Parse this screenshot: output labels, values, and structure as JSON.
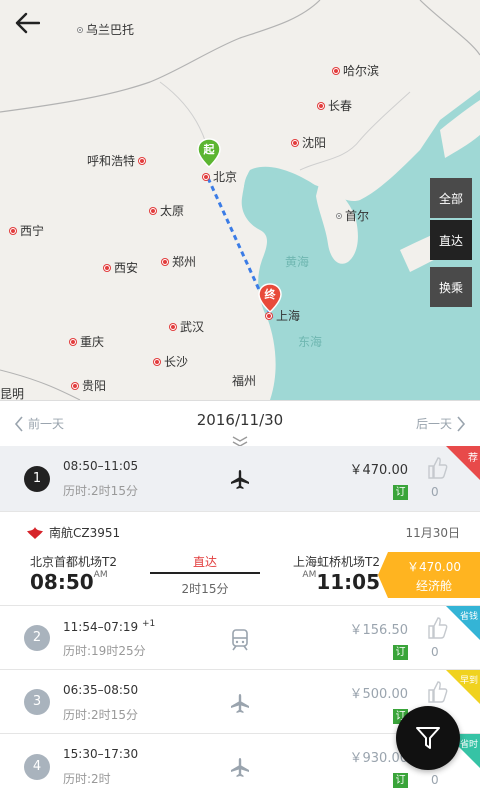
{
  "map": {
    "cities": {
      "wulanbatuo": "乌兰巴托",
      "haerbin": "哈尔滨",
      "changchun": "长春",
      "shenyang": "沈阳",
      "huhehaote": "呼和浩特",
      "beijing": "北京",
      "taiyuan": "太原",
      "shouer": "首尔",
      "xining": "西宁",
      "xian": "西安",
      "zhengzhou": "郑州",
      "wuhan": "武汉",
      "shanghai": "上海",
      "chongqing": "重庆",
      "changsha": "长沙",
      "kunming": "昆明",
      "guiyang": "贵阳",
      "fuzhou": "福州"
    },
    "seas": {
      "huanghai": "黄海",
      "donghai": "东海"
    },
    "origin_pin": "起",
    "dest_pin": "终",
    "filters": [
      "全部",
      "直达",
      "换乘"
    ],
    "active_filter": "直达"
  },
  "datebar": {
    "prev": "前一天",
    "date": "2016/11/30",
    "next": "后一天"
  },
  "routes": [
    {
      "index": "1",
      "times": "08:50–11:05",
      "next_day": "",
      "duration": "历时:2时15分",
      "mode": "plane",
      "price": "￥470.00",
      "ding": "订",
      "likes": "0",
      "corner_label": "荐",
      "corner_color": "#e84a4a"
    },
    {
      "index": "2",
      "times": "11:54–07:19",
      "next_day": "+1",
      "duration": "历时:19时25分",
      "mode": "train",
      "price": "￥156.50",
      "ding": "订",
      "likes": "0",
      "corner_label": "省钱",
      "corner_color": "#34b4d6"
    },
    {
      "index": "3",
      "times": "06:35–08:50",
      "next_day": "",
      "duration": "历时:2时15分",
      "mode": "plane",
      "price": "￥500.00",
      "ding": "订",
      "likes": "0",
      "corner_label": "早到",
      "corner_color": "#f0d21f"
    },
    {
      "index": "4",
      "times": "15:30–17:30",
      "next_day": "",
      "duration": "历时:2时",
      "mode": "plane",
      "price": "￥930.00",
      "ding": "订",
      "likes": "0",
      "corner_label": "省时",
      "corner_color": "#36c3a5"
    }
  ],
  "flight_detail": {
    "airline_flight": "南航CZ3951",
    "date": "11月30日",
    "dep_airport": "北京首都机场T2",
    "dep_time": "08:50",
    "dep_ampm": "AM",
    "direct": "直达",
    "duration": "2时15分",
    "arr_airport": "上海虹桥机场T2",
    "arr_time": "11:05",
    "arr_ampm": "AM",
    "price": "￥470.00",
    "cabin": "经济舱"
  },
  "colors": {
    "accent_red": "#e23d3d",
    "route_blue": "#3b7ce6",
    "sea": "#72c6c5",
    "ding_green": "#3aa43a",
    "tag_orange": "#ffb420"
  }
}
